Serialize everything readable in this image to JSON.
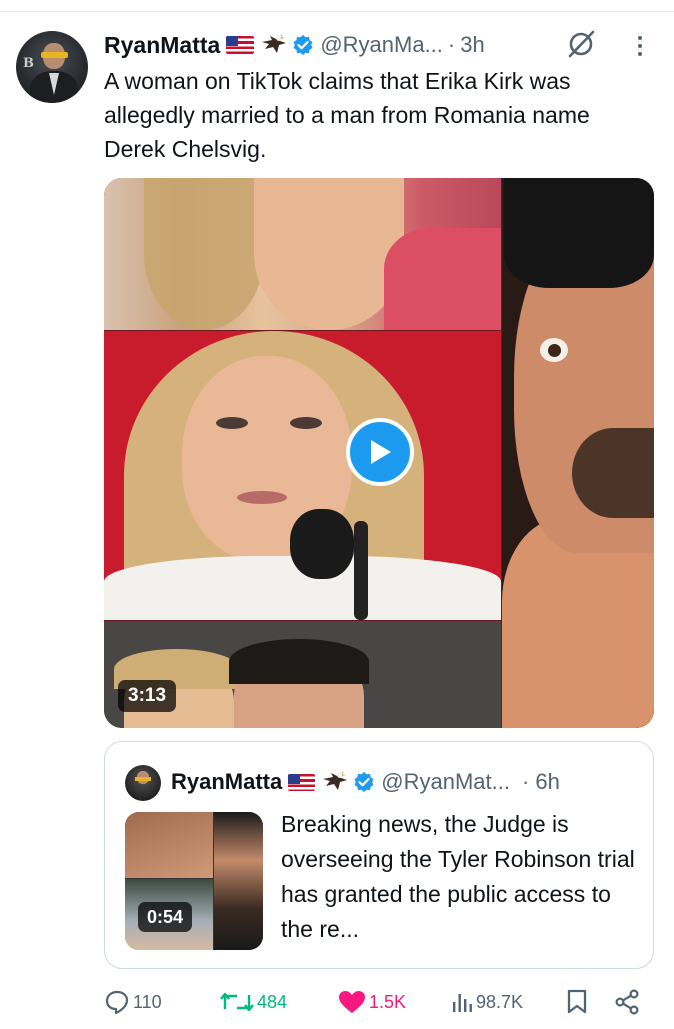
{
  "post": {
    "author_name": "RyanMatta",
    "handle": "@RyanMa...",
    "separator": "·",
    "time": "3h",
    "text": "A woman on TikTok claims that Erika Kirk was allegedly married to a man from Romania name Derek Chelsvig.",
    "video_duration": "3:13",
    "avatar_letter": "B"
  },
  "quote": {
    "author_name": "RyanMatta",
    "handle": "@RyanMat...",
    "time": "· 6h",
    "text": "Breaking news, the Judge is overseeing the Tyler Robinson trial has granted the public access to the re...",
    "video_duration": "0:54"
  },
  "actions": {
    "replies": "110",
    "reposts": "484",
    "likes": "1.5K",
    "views": "98.7K"
  },
  "colors": {
    "accent": "#1d9bf0",
    "repost": "#00ba7c",
    "like": "#f91880",
    "muted": "#536471"
  },
  "icons": [
    "flag-icon",
    "eagle-icon",
    "verified-badge-icon",
    "grok-icon",
    "more-icon",
    "play-icon",
    "reply-icon",
    "repost-icon",
    "like-icon",
    "views-icon",
    "bookmark-icon",
    "share-icon"
  ]
}
